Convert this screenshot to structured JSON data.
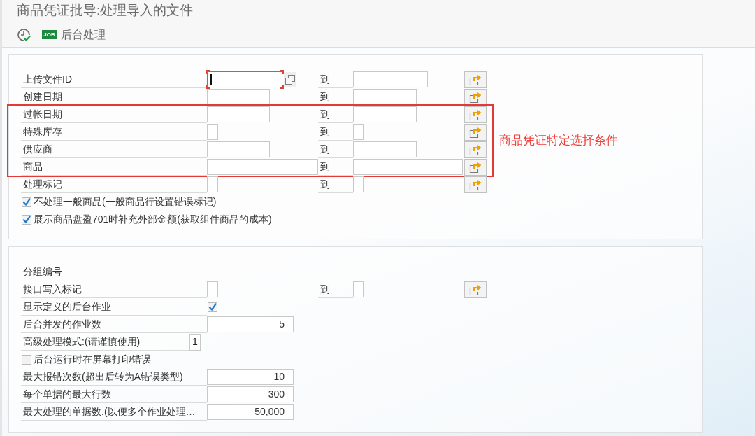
{
  "window": {
    "title": "商品凭证批导:处理导入的文件"
  },
  "toolbar": [
    {
      "kind": "execute"
    },
    {
      "kind": "badge_button",
      "badge": "JOB",
      "label": "后台处理"
    }
  ],
  "selection_block": {
    "annotation": "商品凭证特定选择条件",
    "rows": [
      {
        "kind": "range",
        "label": "上传文件ID",
        "to_label": "到",
        "focused": true,
        "highlighted": false
      },
      {
        "kind": "range",
        "label": "创建日期",
        "to_label": "到",
        "focused": false,
        "highlighted": false
      },
      {
        "kind": "range",
        "label": "过帐日期",
        "to_label": "到",
        "focused": false,
        "highlighted": true
      },
      {
        "kind": "range",
        "label": "特殊库存",
        "to_label": "到",
        "focused": false,
        "highlighted": true
      },
      {
        "kind": "range",
        "label": "供应商",
        "to_label": "到",
        "focused": false,
        "highlighted": true
      },
      {
        "kind": "range",
        "label": "商品",
        "to_label": "到",
        "focused": false,
        "highlighted": true
      },
      {
        "kind": "range",
        "label": "处理标记",
        "to_label": "到",
        "focused": false,
        "highlighted": false
      },
      {
        "kind": "checkbox",
        "label": "不处理一般商品(一般商品行设置错误标记)",
        "checked": true
      },
      {
        "kind": "checkbox",
        "label": "展示商品盘盈701时补充外部金额(获取组件商品的成本)",
        "checked": true
      }
    ]
  },
  "processing_block": {
    "rows": [
      {
        "kind": "heading",
        "label": "分组编号"
      },
      {
        "kind": "range",
        "label": "接口写入标记",
        "to_label": "到",
        "focused": false,
        "highlighted": false
      },
      {
        "kind": "flag",
        "label": "显示定义的后台作业",
        "checked": true
      },
      {
        "kind": "number",
        "label": "后台并发的作业数",
        "value": "5"
      },
      {
        "kind": "compact_number",
        "label": "高级处理模式:(请谨慎使用)",
        "value": "1"
      },
      {
        "kind": "checkbox",
        "label": "后台运行时在屏幕打印错误",
        "checked": false
      },
      {
        "kind": "number",
        "label": "最大报错次数(超出后转为A错误类型)",
        "value": "10"
      },
      {
        "kind": "number",
        "label": "每个单据的最大行数",
        "value": "300"
      },
      {
        "kind": "number",
        "label": "最大处理的单据数.(以便多个作业处理…",
        "value": "50,000"
      }
    ]
  }
}
